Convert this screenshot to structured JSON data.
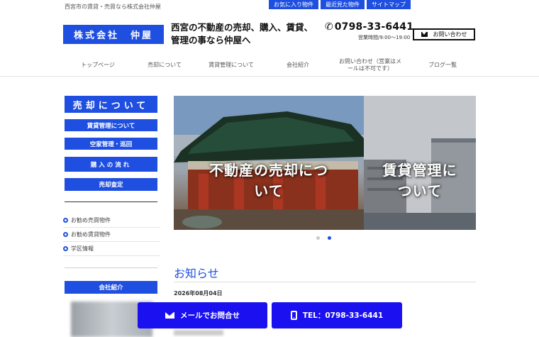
{
  "header": {
    "tagline": "西宮市の賃貸・売買なら株式会社仲屋",
    "top_links": [
      "お気に入り物件",
      "最近見た物件",
      "サイトマップ"
    ],
    "logo_text": "株式会社　仲屋",
    "headline": "西宮の不動産の売却、購入、賃貸、管理の事なら仲屋へ",
    "phone": "0798-33-6441",
    "hours": "営業時間/9:00～19:00",
    "contact_label": "お問い合わせ"
  },
  "nav": {
    "items": [
      "トップページ",
      "売却について",
      "賃貸管理について",
      "会社紹介",
      "お問い合わせ（営業はメールは不可です）",
      "ブログ一覧"
    ]
  },
  "sidebar": {
    "main_label": "売却について",
    "buttons": [
      "賃貸管理について",
      "空家管理・巡回",
      "購入の流れ",
      "売却査定"
    ],
    "links": [
      "お勧め売買物件",
      "お勧め賃貸物件",
      "学区情報"
    ],
    "company_label": "会社紹介"
  },
  "slider": {
    "slides": [
      {
        "caption": "不動産の売却について"
      },
      {
        "caption": "賃貸管理について"
      }
    ],
    "active_index": 1,
    "dot_count": 2
  },
  "news": {
    "title": "お知らせ",
    "date": "2026年08月04日"
  },
  "footer_buttons": {
    "mail_label": "メールでお問合せ",
    "tel_label": "TEL：0798-33-6441"
  },
  "colors": {
    "accent": "#1f4fe0",
    "footer_button": "#1a10f0"
  },
  "icons": {
    "phone": "phone-icon",
    "contact": "envelope-icon",
    "bullet": "circle-bullet-icon",
    "mail": "envelope-icon",
    "tel": "mobile-phone-icon"
  }
}
